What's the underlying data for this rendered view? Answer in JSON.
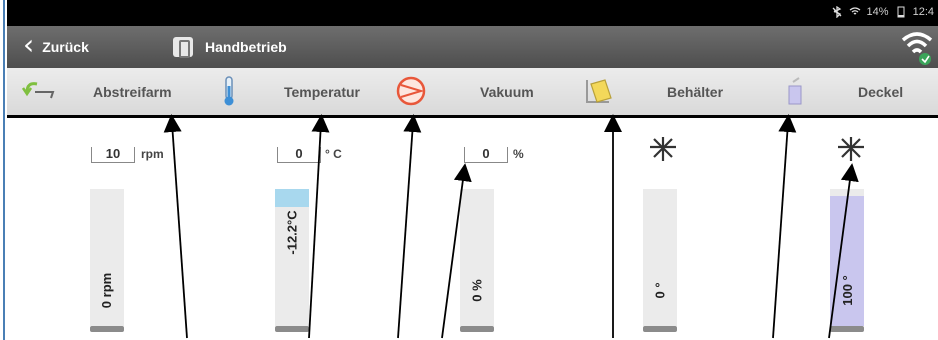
{
  "statusbar": {
    "battery": "14%",
    "time": "12:4"
  },
  "header": {
    "back_label": "Zurück",
    "mode_label": "Handbetrieb"
  },
  "tabs": [
    {
      "label": "Abstreifarm",
      "icon": "arm-icon"
    },
    {
      "label": "Temperatur",
      "icon": "thermometer-icon"
    },
    {
      "label": "Vakuum",
      "icon": "vacuum-icon"
    },
    {
      "label": "Behälter",
      "icon": "container-icon"
    },
    {
      "label": "Deckel",
      "icon": "lid-icon"
    }
  ],
  "controls": {
    "abstreifarm": {
      "value": "10",
      "unit": "rpm",
      "bar_label": "0 rpm",
      "fill_fraction": 0
    },
    "temperatur": {
      "value": "0",
      "unit": "° C",
      "bar_label": "-12.2°C",
      "fill_fraction": 0.13
    },
    "vakuum": {
      "value": "0",
      "unit": "%",
      "bar_label": "0 %",
      "fill_fraction": 0
    },
    "behaelter": {
      "bar_label": "0 °",
      "fill_fraction": 0
    },
    "deckel": {
      "bar_label": "100 °",
      "fill_fraction": 0.95
    }
  },
  "colors": {
    "temperature_fill": "#a8d8ee",
    "lid_fill": "#c9c6ee",
    "bar_bg": "#ebebeb",
    "accent_orange": "#e8573a"
  }
}
